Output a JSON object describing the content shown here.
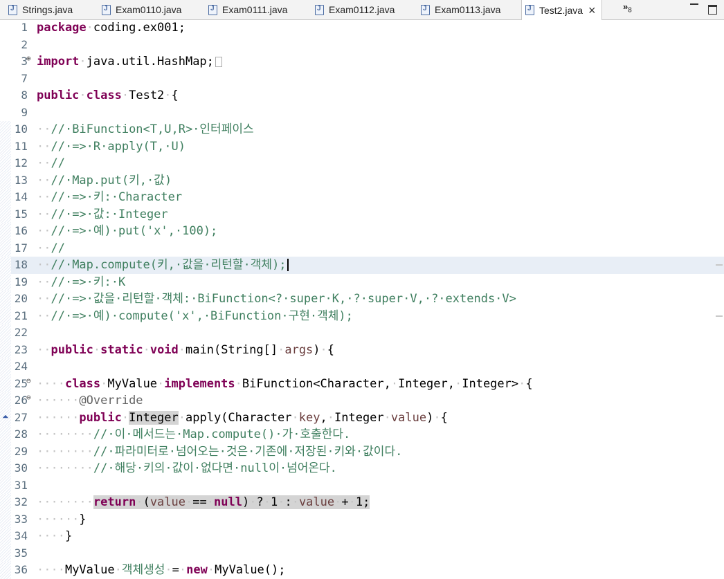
{
  "tabs": [
    {
      "label": "Strings.java",
      "active": false
    },
    {
      "label": "Exam0110.java",
      "active": false
    },
    {
      "label": "Exam0111.java",
      "active": false
    },
    {
      "label": "Exam0112.java",
      "active": false
    },
    {
      "label": "Exam0113.java",
      "active": false
    },
    {
      "label": "Test2.java",
      "active": true
    }
  ],
  "overflow": {
    "symbol": "»",
    "count": "8"
  },
  "editor": {
    "current_line": 18,
    "lines": [
      {
        "n": "1",
        "segs": [
          [
            "kw",
            "package"
          ],
          [
            "ws",
            "·"
          ],
          [
            "t",
            "coding.ex001;"
          ]
        ]
      },
      {
        "n": "2",
        "segs": []
      },
      {
        "n": "3",
        "fold": "plus",
        "segs": [
          [
            "kw",
            "import"
          ],
          [
            "ws",
            "·"
          ],
          [
            "t",
            "java.util.HashMap;"
          ]
        ],
        "box": true
      },
      {
        "n": "7",
        "segs": []
      },
      {
        "n": "8",
        "segs": [
          [
            "kw",
            "public"
          ],
          [
            "ws",
            "·"
          ],
          [
            "kw",
            "class"
          ],
          [
            "ws",
            "·"
          ],
          [
            "t",
            "Test2"
          ],
          [
            "ws",
            "·"
          ],
          [
            "t",
            "{"
          ]
        ]
      },
      {
        "n": "9",
        "segs": []
      },
      {
        "n": "10",
        "segs": [
          [
            "ws",
            "··"
          ],
          [
            "cm",
            "//·BiFunction<T,U,R>·인터페이스"
          ]
        ]
      },
      {
        "n": "11",
        "segs": [
          [
            "ws",
            "··"
          ],
          [
            "cm",
            "//·=>·R·apply(T,·U)"
          ]
        ]
      },
      {
        "n": "12",
        "segs": [
          [
            "ws",
            "··"
          ],
          [
            "cm",
            "//"
          ]
        ]
      },
      {
        "n": "13",
        "segs": [
          [
            "ws",
            "··"
          ],
          [
            "cm",
            "//·Map.put(키,·값)"
          ]
        ]
      },
      {
        "n": "14",
        "segs": [
          [
            "ws",
            "··"
          ],
          [
            "cm",
            "//·=>·키:·Character"
          ]
        ]
      },
      {
        "n": "15",
        "segs": [
          [
            "ws",
            "··"
          ],
          [
            "cm",
            "//·=>·값:·Integer"
          ]
        ]
      },
      {
        "n": "16",
        "segs": [
          [
            "ws",
            "··"
          ],
          [
            "cm",
            "//·=>·예)·put('x',·100);"
          ]
        ]
      },
      {
        "n": "17",
        "segs": [
          [
            "ws",
            "··"
          ],
          [
            "cm",
            "//"
          ]
        ]
      },
      {
        "n": "18",
        "cur": true,
        "segs": [
          [
            "ws",
            "··"
          ],
          [
            "cm",
            "//·Map.compute(키,·값을·리턴할·객체);"
          ]
        ],
        "caret": true
      },
      {
        "n": "19",
        "segs": [
          [
            "ws",
            "··"
          ],
          [
            "cm",
            "//·=>·키:·K"
          ]
        ]
      },
      {
        "n": "20",
        "segs": [
          [
            "ws",
            "··"
          ],
          [
            "cm",
            "//·=>·값을·리턴할·객체:·BiFunction<?·super·K,·?·super·V,·?·extends·V>"
          ]
        ]
      },
      {
        "n": "21",
        "segs": [
          [
            "ws",
            "··"
          ],
          [
            "cm",
            "//·=>·예)·compute('x',·BiFunction·구현·객체);"
          ]
        ]
      },
      {
        "n": "22",
        "segs": []
      },
      {
        "n": "23",
        "segs": [
          [
            "ws",
            "··"
          ],
          [
            "kw",
            "public"
          ],
          [
            "ws",
            "·"
          ],
          [
            "kw",
            "static"
          ],
          [
            "ws",
            "·"
          ],
          [
            "kw",
            "void"
          ],
          [
            "ws",
            "·"
          ],
          [
            "t",
            "main(String[]"
          ],
          [
            "ws",
            "·"
          ],
          [
            "var",
            "args"
          ],
          [
            "t",
            ")"
          ],
          [
            "ws",
            "·"
          ],
          [
            "t",
            "{"
          ]
        ]
      },
      {
        "n": "24",
        "segs": []
      },
      {
        "n": "25",
        "fold": "minus",
        "segs": [
          [
            "ws",
            "····"
          ],
          [
            "kw",
            "class"
          ],
          [
            "ws",
            "·"
          ],
          [
            "t",
            "MyValue"
          ],
          [
            "ws",
            "·"
          ],
          [
            "kw",
            "implements"
          ],
          [
            "ws",
            "·"
          ],
          [
            "t",
            "BiFunction<Character,"
          ],
          [
            "ws",
            "·"
          ],
          [
            "t",
            "Integer,"
          ],
          [
            "ws",
            "·"
          ],
          [
            "t",
            "Integer>"
          ],
          [
            "ws",
            "·"
          ],
          [
            "t",
            "{"
          ]
        ]
      },
      {
        "n": "26",
        "fold": "minus",
        "segs": [
          [
            "ws",
            "······"
          ],
          [
            "an",
            "@Override"
          ]
        ]
      },
      {
        "n": "27",
        "arrow": true,
        "segs": [
          [
            "ws",
            "······"
          ],
          [
            "kw",
            "public"
          ],
          [
            "ws",
            "·"
          ],
          [
            "hl",
            "Integer"
          ],
          [
            "ws",
            "·"
          ],
          [
            "t",
            "apply(Character"
          ],
          [
            "ws",
            "·"
          ],
          [
            "var",
            "key"
          ],
          [
            "t",
            ","
          ],
          [
            "ws",
            "·"
          ],
          [
            "t",
            "Integer"
          ],
          [
            "ws",
            "·"
          ],
          [
            "var",
            "value"
          ],
          [
            "t",
            ")"
          ],
          [
            "ws",
            "·"
          ],
          [
            "t",
            "{"
          ]
        ]
      },
      {
        "n": "28",
        "segs": [
          [
            "ws",
            "········"
          ],
          [
            "cm",
            "//·이·메서드는·Map.compute()·가·호출한다."
          ]
        ]
      },
      {
        "n": "29",
        "segs": [
          [
            "ws",
            "········"
          ],
          [
            "cm",
            "//·파라미터로·넘어오는·것은·기존에·저장된·키와·값이다."
          ]
        ]
      },
      {
        "n": "30",
        "segs": [
          [
            "ws",
            "········"
          ],
          [
            "cm",
            "//·해당·키의·값이·없다면·null이·넘어온다."
          ]
        ]
      },
      {
        "n": "31",
        "segs": []
      },
      {
        "n": "32",
        "hlline": true,
        "segs": [
          [
            "ws",
            "········"
          ],
          [
            "kw",
            "return"
          ],
          [
            "ws",
            "·"
          ],
          [
            "t",
            "("
          ],
          [
            "var",
            "value"
          ],
          [
            "ws",
            "·"
          ],
          [
            "t",
            "=="
          ],
          [
            "ws",
            "·"
          ],
          [
            "kw",
            "null"
          ],
          [
            "t",
            ")"
          ],
          [
            "ws",
            "·"
          ],
          [
            "t",
            "?"
          ],
          [
            "ws",
            "·"
          ],
          [
            "t",
            "1"
          ],
          [
            "ws",
            "·"
          ],
          [
            "t",
            ":"
          ],
          [
            "ws",
            "·"
          ],
          [
            "var",
            "value"
          ],
          [
            "ws",
            "·"
          ],
          [
            "t",
            "+"
          ],
          [
            "ws",
            "·"
          ],
          [
            "t",
            "1;"
          ]
        ]
      },
      {
        "n": "33",
        "segs": [
          [
            "ws",
            "······"
          ],
          [
            "t",
            "}"
          ]
        ]
      },
      {
        "n": "34",
        "segs": [
          [
            "ws",
            "····"
          ],
          [
            "t",
            "}"
          ]
        ]
      },
      {
        "n": "35",
        "segs": []
      },
      {
        "n": "36",
        "segs": [
          [
            "ws",
            "····"
          ],
          [
            "t",
            "MyValue"
          ],
          [
            "ws",
            "·"
          ],
          [
            "cm",
            "객체생성"
          ],
          [
            "ws",
            "·"
          ],
          [
            "t",
            "="
          ],
          [
            "ws",
            "·"
          ],
          [
            "kw",
            "new"
          ],
          [
            "ws",
            "·"
          ],
          [
            "t",
            "MyValue();"
          ]
        ]
      }
    ]
  }
}
